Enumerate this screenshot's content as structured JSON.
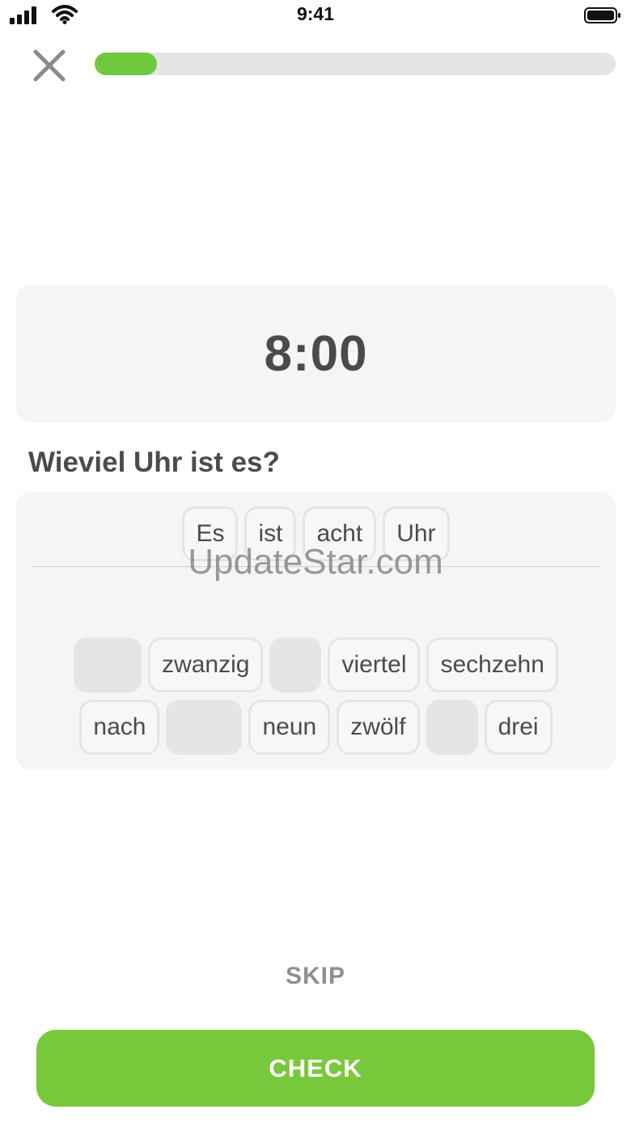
{
  "status_bar": {
    "time": "9:41"
  },
  "progress": {
    "fraction": 0.12
  },
  "prompt": {
    "value": "8:00"
  },
  "question": "Wieviel Uhr ist es?",
  "answer": {
    "selected": [
      "Es",
      "ist",
      "acht",
      "Uhr"
    ]
  },
  "word_bank": {
    "row1": [
      {
        "word": "",
        "used": true
      },
      {
        "word": "zwanzig",
        "used": false
      },
      {
        "word": "",
        "used": true
      },
      {
        "word": "viertel",
        "used": false
      },
      {
        "word": "sechzehn",
        "used": false
      }
    ],
    "row2": [
      {
        "word": "nach",
        "used": false
      },
      {
        "word": "",
        "used": true
      },
      {
        "word": "neun",
        "used": false
      },
      {
        "word": "zwölf",
        "used": false
      },
      {
        "word": "",
        "used": true
      },
      {
        "word": "drei",
        "used": false
      }
    ]
  },
  "watermark": "UpdateStar.com",
  "skip_label": "SKIP",
  "check_label": "CHECK",
  "colors": {
    "accent": "#78c83c",
    "progress": "#6fc83d",
    "card": "#f5f5f5",
    "text": "#4b4b4b"
  }
}
